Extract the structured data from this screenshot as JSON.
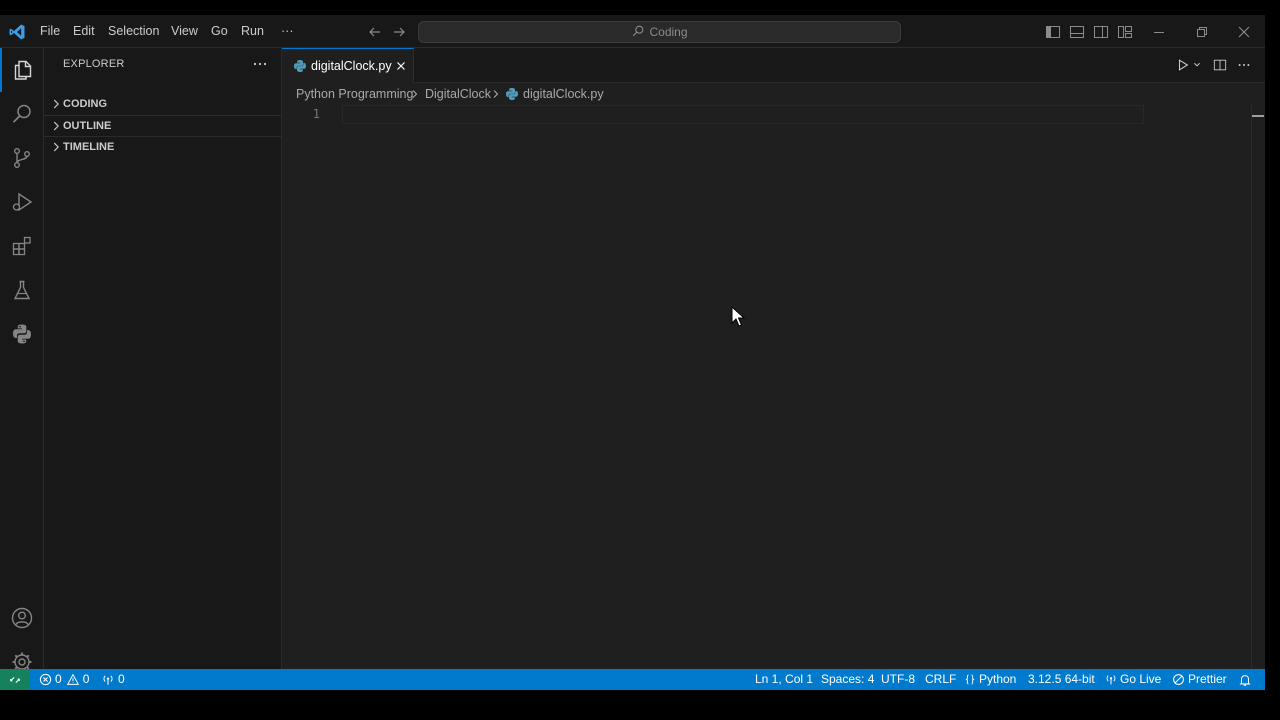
{
  "titlebar": {
    "menu": [
      "File",
      "Edit",
      "Selection",
      "View",
      "Go",
      "Run",
      "···"
    ],
    "search": "Coding"
  },
  "sidebar": {
    "title": "EXPLORER",
    "sections": [
      "CODING",
      "OUTLINE",
      "TIMELINE"
    ]
  },
  "editor": {
    "tab_label": "digitalClock.py",
    "breadcrumb": [
      "Python Programming",
      "DigitalClock",
      "digitalClock.py"
    ],
    "line_number": "1"
  },
  "statusbar": {
    "errors": "0",
    "warnings": "0",
    "ports": "0",
    "position": "Ln 1, Col 1",
    "spaces": "Spaces: 4",
    "encoding": "UTF-8",
    "eol": "CRLF",
    "language": "Python",
    "interpreter": "3.12.5 64-bit",
    "golive": "Go Live",
    "prettier": "Prettier"
  },
  "colors": {
    "accent": "#0078d4",
    "statusbar": "#007acc",
    "remote": "#16825d",
    "python_icon": "#519aba"
  }
}
